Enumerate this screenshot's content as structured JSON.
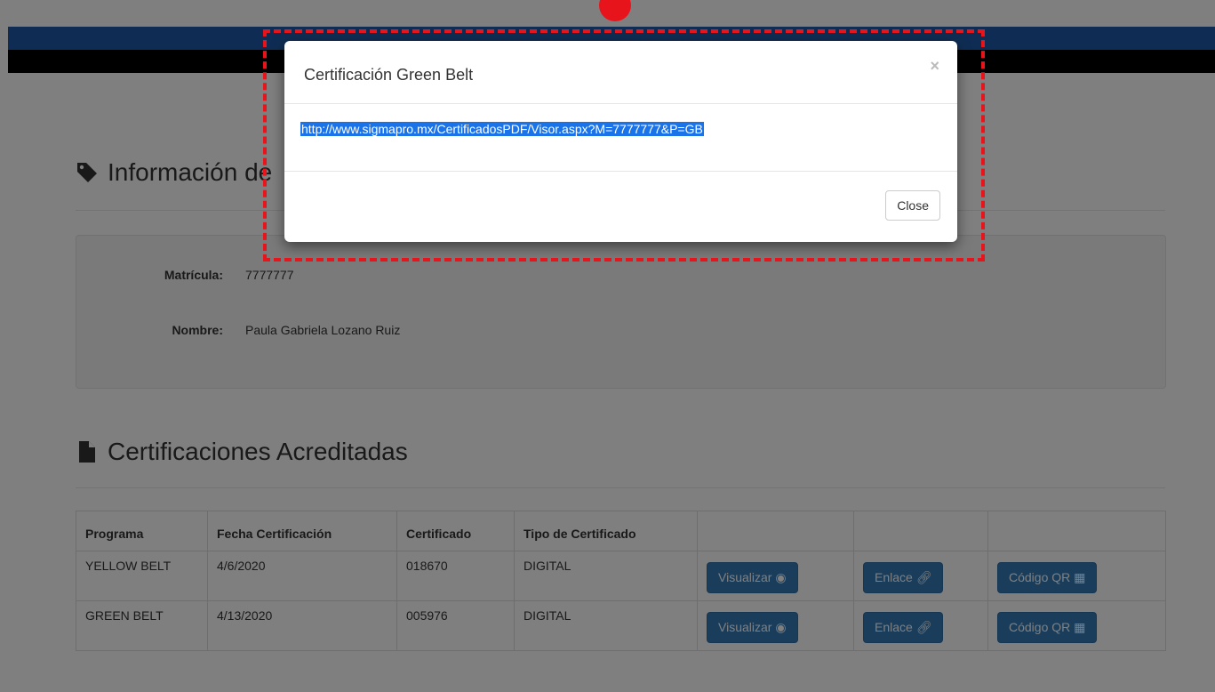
{
  "info_section": {
    "title": "Información de"
  },
  "info": {
    "matricula_label": "Matrícula:",
    "matricula_value": "7777777",
    "nombre_label": "Nombre:",
    "nombre_value": "Paula Gabriela Lozano Ruiz"
  },
  "certs_section": {
    "title": "Certificaciones Acreditadas"
  },
  "table": {
    "headers": [
      "Programa",
      "Fecha Certificación",
      "Certificado",
      "Tipo de Certificado",
      "",
      "",
      ""
    ],
    "rows": [
      {
        "programa": "YELLOW BELT",
        "fecha": "4/6/2020",
        "certificado": "018670",
        "tipo": "DIGITAL"
      },
      {
        "programa": "GREEN BELT",
        "fecha": "4/13/2020",
        "certificado": "005976",
        "tipo": "DIGITAL"
      }
    ],
    "buttons": {
      "visualizar": "Visualizar",
      "enlace": "Enlace",
      "qr": "Código QR"
    }
  },
  "modal": {
    "title": "Certificación Green Belt",
    "close_x": "×",
    "link": "http://www.sigmapro.mx/CertificadosPDF/Visor.aspx?M=7777777&P=GB",
    "close_button": "Close"
  },
  "colors": {
    "primary_button": "#337ab7",
    "topbar_blue": "#1e5aa8",
    "annotation_red": "#e8141b",
    "selection_blue": "#1a73e8"
  }
}
